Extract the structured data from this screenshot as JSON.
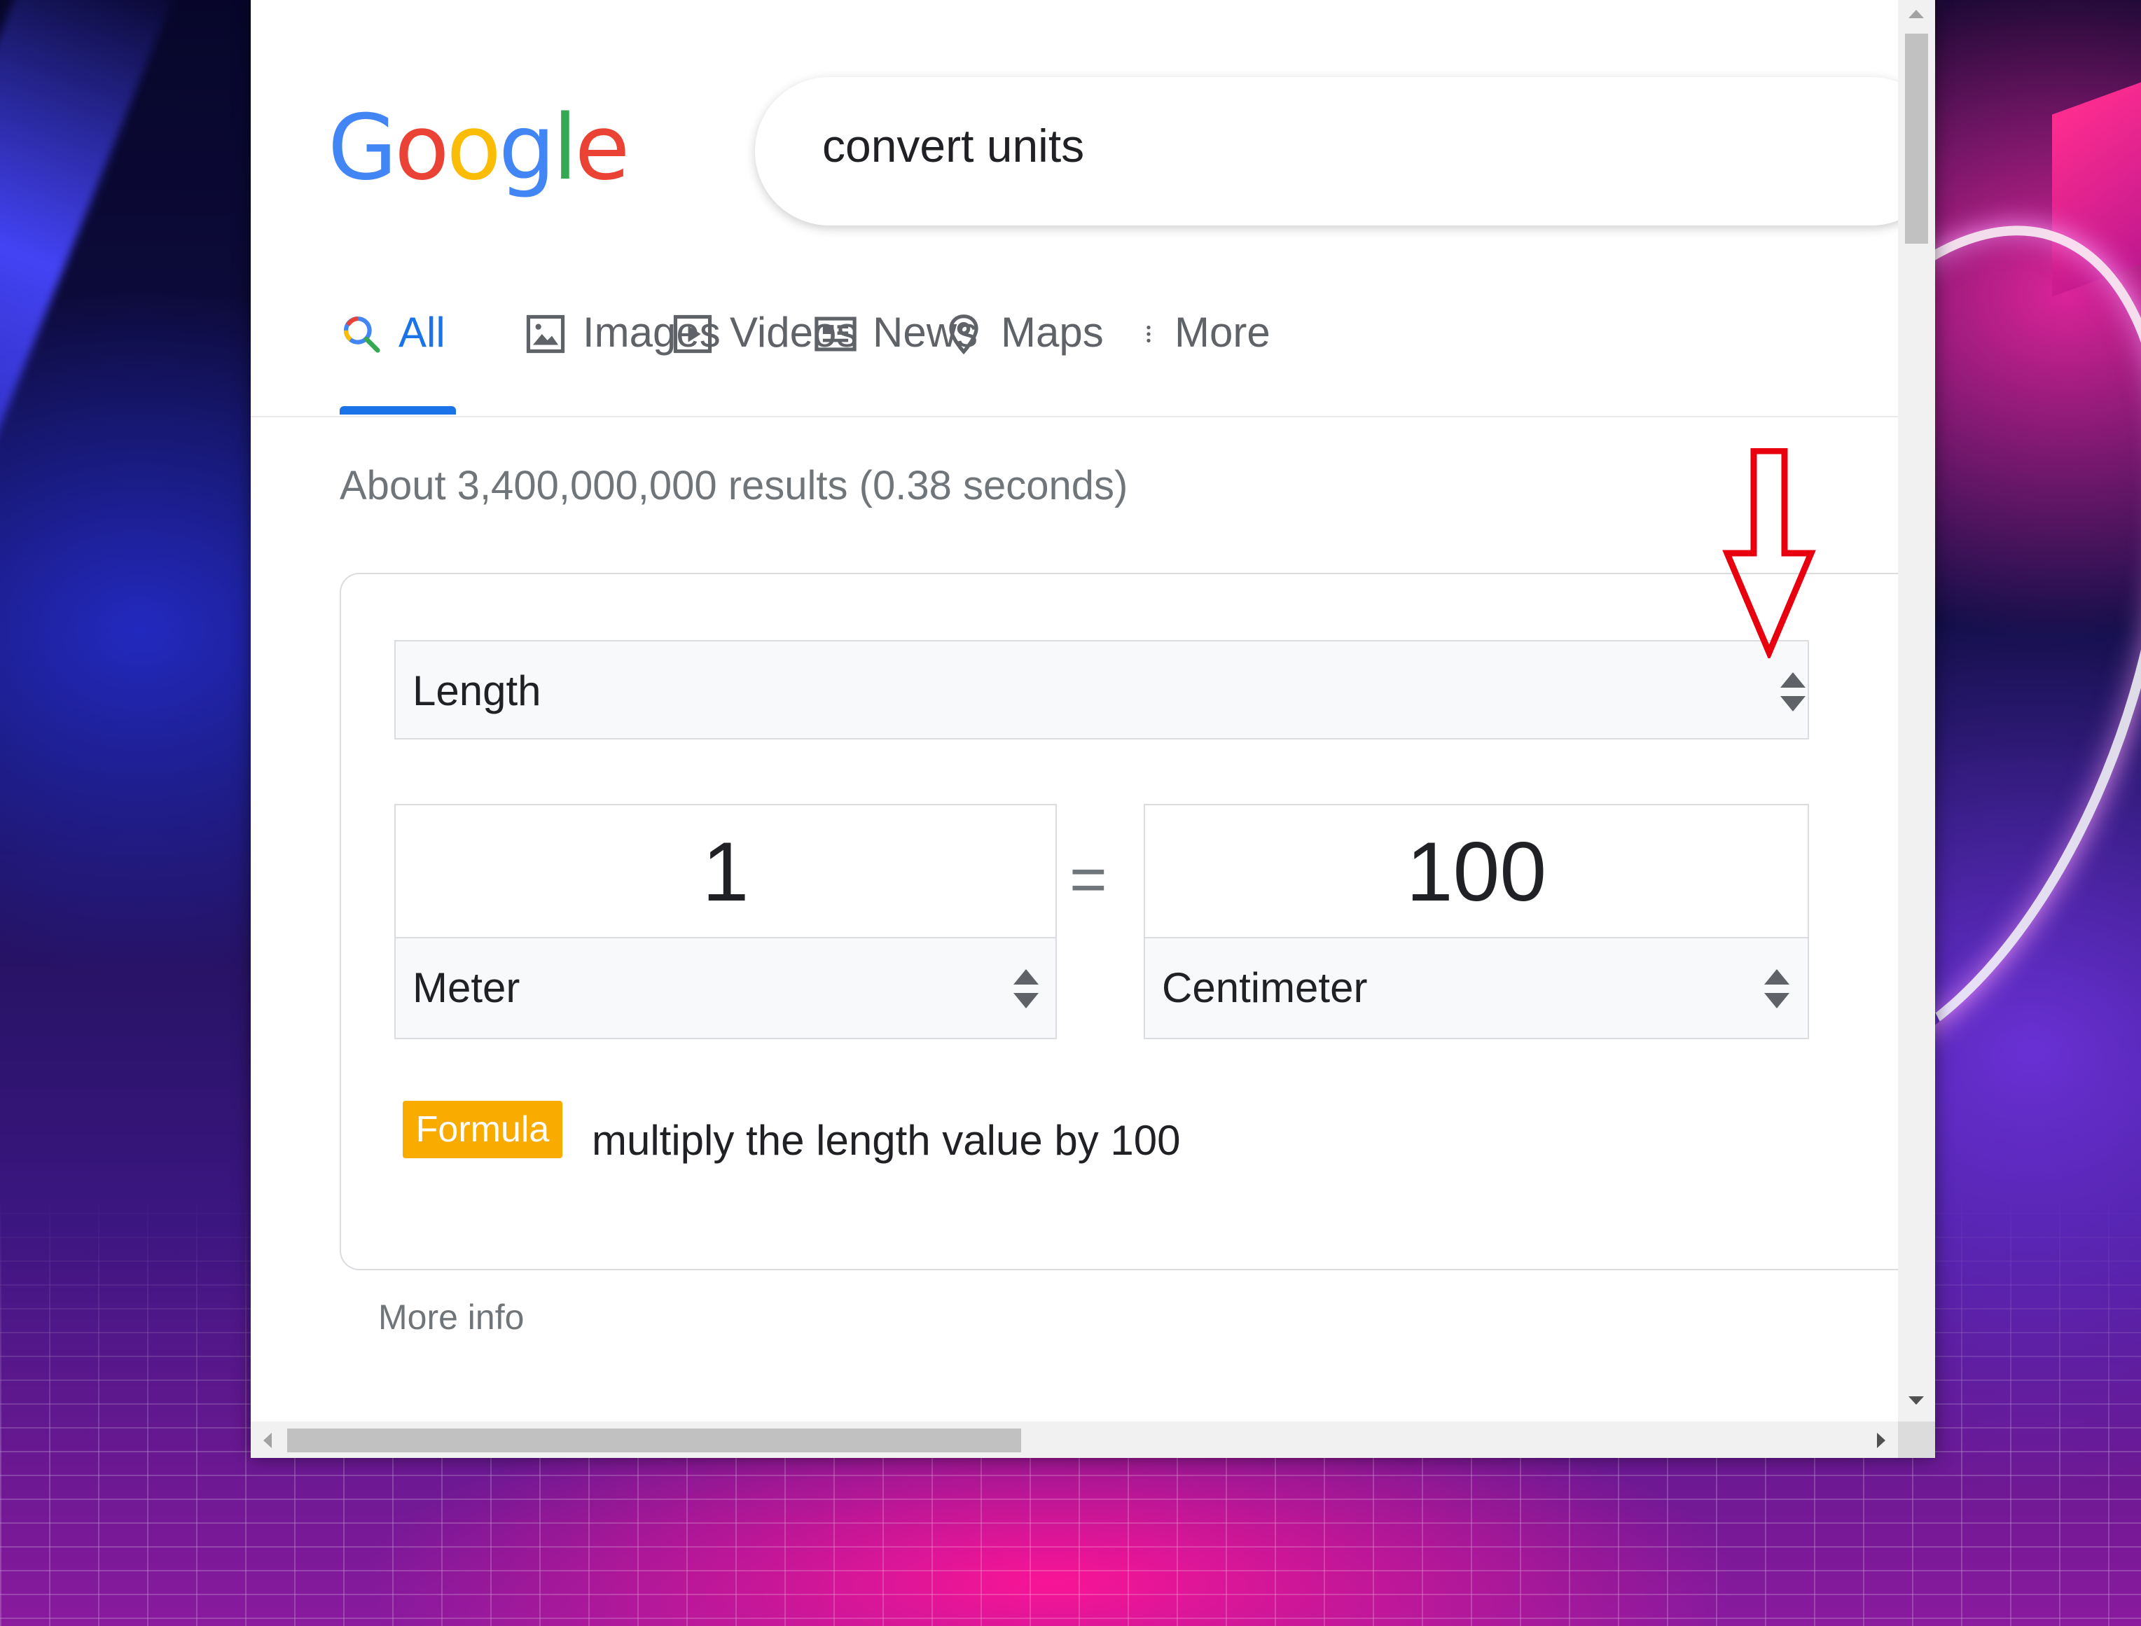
{
  "logo": {
    "letters": [
      "G",
      "o",
      "o",
      "g",
      "l",
      "e"
    ]
  },
  "search": {
    "query": "convert units"
  },
  "tabs": [
    {
      "label": "All",
      "icon": "search-icon",
      "active": true
    },
    {
      "label": "Images",
      "icon": "image-icon"
    },
    {
      "label": "Videos",
      "icon": "video-icon"
    },
    {
      "label": "News",
      "icon": "news-icon"
    },
    {
      "label": "Maps",
      "icon": "map-pin-icon"
    },
    {
      "label": "More",
      "icon": "kebab-menu-icon"
    }
  ],
  "results_stats": "About 3,400,000,000 results (0.38 seconds)",
  "converter": {
    "category": "Length",
    "from": {
      "value": "1",
      "unit": "Meter"
    },
    "equals": "=",
    "to": {
      "value": "100",
      "unit": "Centimeter"
    },
    "formula_badge": "Formula",
    "formula_text": "multiply the length value by 100"
  },
  "more_info": "More info",
  "colors": {
    "google_blue": "#4285f4",
    "google_red": "#ea4335",
    "google_yellow": "#fbbc05",
    "google_green": "#34a853",
    "active_tab": "#1a73e8",
    "formula_badge": "#f9ab00",
    "annotation_arrow": "#e8000f"
  }
}
